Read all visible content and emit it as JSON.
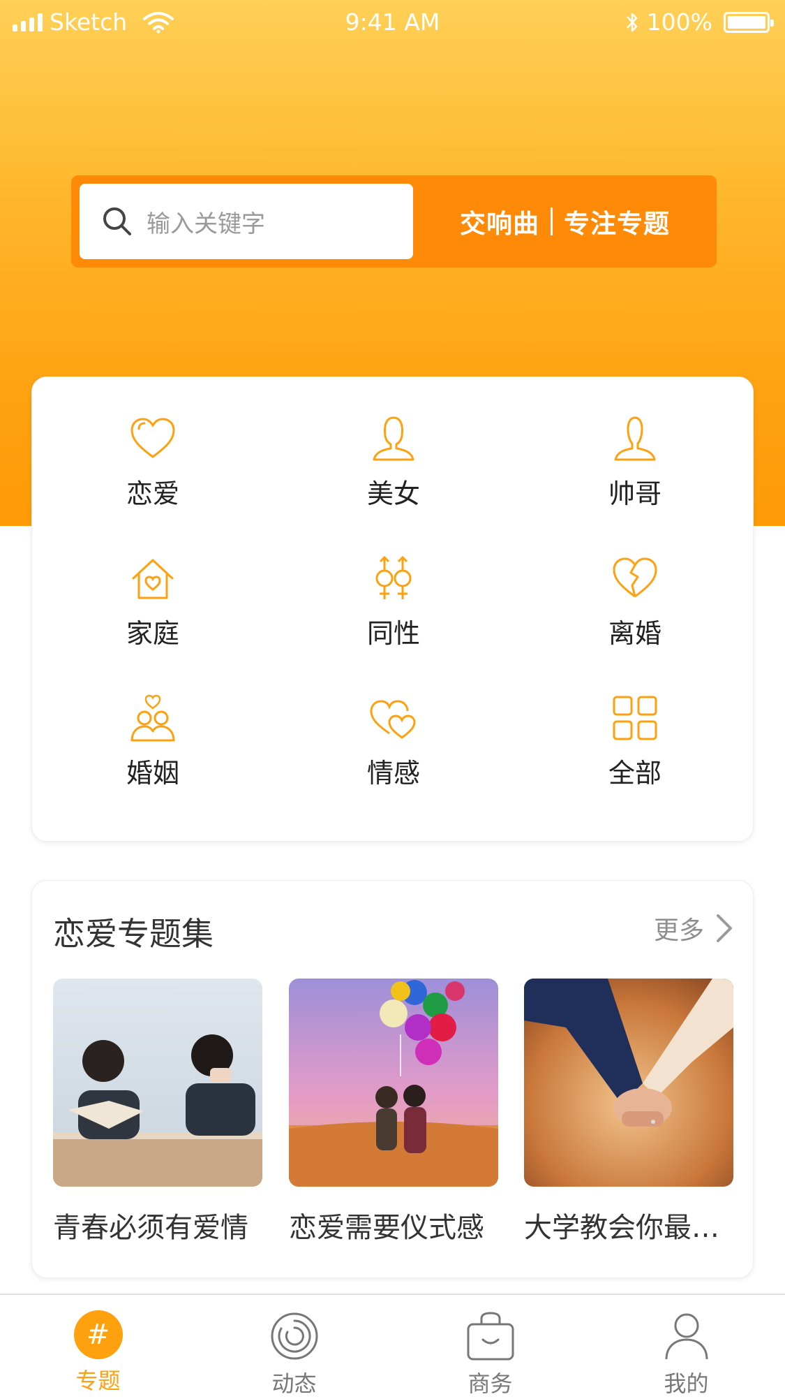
{
  "status_bar": {
    "carrier": "Sketch",
    "time": "9:41 AM",
    "battery": "100%"
  },
  "search": {
    "placeholder": "输入关键字",
    "slogan_left": "交响曲",
    "slogan_right": "专注专题"
  },
  "categories": [
    {
      "label": "恋爱",
      "icon": "heart-icon"
    },
    {
      "label": "美女",
      "icon": "woman-icon"
    },
    {
      "label": "帅哥",
      "icon": "man-icon"
    },
    {
      "label": "家庭",
      "icon": "house-heart-icon"
    },
    {
      "label": "同性",
      "icon": "same-sex-icon"
    },
    {
      "label": "离婚",
      "icon": "broken-heart-icon"
    },
    {
      "label": "婚姻",
      "icon": "couple-icon"
    },
    {
      "label": "情感",
      "icon": "double-heart-icon"
    },
    {
      "label": "全部",
      "icon": "grid-icon"
    }
  ],
  "topic_section": {
    "title": "恋爱专题集",
    "more": "更多",
    "items": [
      {
        "caption": "青春必须有爱情"
      },
      {
        "caption": "恋爱需要仪式感"
      },
      {
        "caption": "大学教会你最…"
      }
    ]
  },
  "tabbar": [
    {
      "label": "专题",
      "icon": "hash-icon",
      "active": true
    },
    {
      "label": "动态",
      "icon": "activity-icon",
      "active": false
    },
    {
      "label": "商务",
      "icon": "shopping-bag-icon",
      "active": false
    },
    {
      "label": "我的",
      "icon": "person-icon",
      "active": false
    }
  ],
  "colors": {
    "accent": "#ffa00e",
    "search_bar": "#ff8a08",
    "hero_top": "#ffd056",
    "hero_bottom": "#ff9a07"
  }
}
